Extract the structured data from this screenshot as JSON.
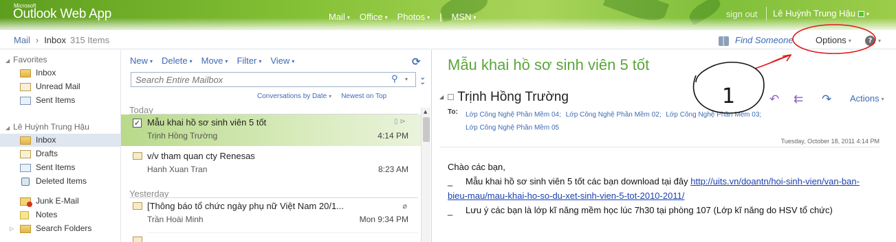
{
  "header": {
    "brand_small": "Microsoft",
    "brand": "Outlook Web App",
    "nav": [
      "Mail",
      "Office",
      "Photos",
      "MSN"
    ],
    "sign_out": "sign out",
    "user": "Lê Huỳnh Trung Hậu"
  },
  "crumbs": {
    "root": "Mail",
    "folder": "Inbox",
    "count": "315 Items",
    "find_someone": "Find Someone",
    "options": "Options",
    "help": "?"
  },
  "favorites": {
    "title": "Favorites",
    "items": [
      "Inbox",
      "Unread Mail",
      "Sent Items"
    ]
  },
  "mailbox": {
    "title": "Lê Huỳnh Trung Hậu",
    "items": [
      "Inbox",
      "Drafts",
      "Sent Items",
      "Deleted Items",
      "Junk E-Mail",
      "Notes",
      "Search Folders"
    ]
  },
  "toolbar": {
    "new": "New",
    "delete": "Delete",
    "move": "Move",
    "filter": "Filter",
    "view": "View"
  },
  "search": {
    "placeholder": "Search Entire Mailbox"
  },
  "sort": {
    "by": "Conversations by Date",
    "order": "Newest on Top"
  },
  "groups": {
    "today": "Today",
    "yesterday": "Yesterday"
  },
  "messages": [
    {
      "subject": "Mẫu khai hồ sơ sinh viên 5 tốt",
      "from": "Trịnh Hồng Trường",
      "time": "4:14 PM"
    },
    {
      "subject": "v/v tham quan cty Renesas",
      "from": "Hanh Xuan Tran",
      "time": "8:23 AM"
    },
    {
      "subject": "[Thông báo tổ chức ngày phụ nữ Việt Nam 20/1...",
      "from": "Trần Hoài Minh",
      "time": "Mon 9:34 PM"
    }
  ],
  "reading": {
    "subject": "Mẫu khai hồ sơ sinh viên 5 tốt",
    "sender": "Trịnh Hồng Trường",
    "actions": "Actions",
    "to_label": "To:",
    "recipients": [
      "Lớp Công Nghệ Phần Mềm 04;",
      "Lớp Công Nghệ Phần Mềm 02;",
      "Lớp Công Nghệ Phần Mềm 03;",
      "Lớp Công Nghệ Phần Mềm 05"
    ],
    "date": "Tuesday, October 18, 2011 4:14 PM",
    "greeting": "Chào các bạn,",
    "dash": "_",
    "line1_text": "Mẫu khai hồ sơ sinh viên 5 tốt các bạn download tại đây",
    "line1_link": "http://uits.vn/doantn/hoi-sinh-vien/van-ban-bieu-mau/mau-khai-ho-so-du-xet-sinh-vien-5-tot-2010-2011/",
    "line2_text": "Lưu ý các bạn là lớp kĩ năng mềm học lúc 7h30 tại phòng 107 (Lớp kĩ năng do HSV tổ chức)"
  },
  "annotation": {
    "number": "1",
    "color": "#e01818"
  }
}
